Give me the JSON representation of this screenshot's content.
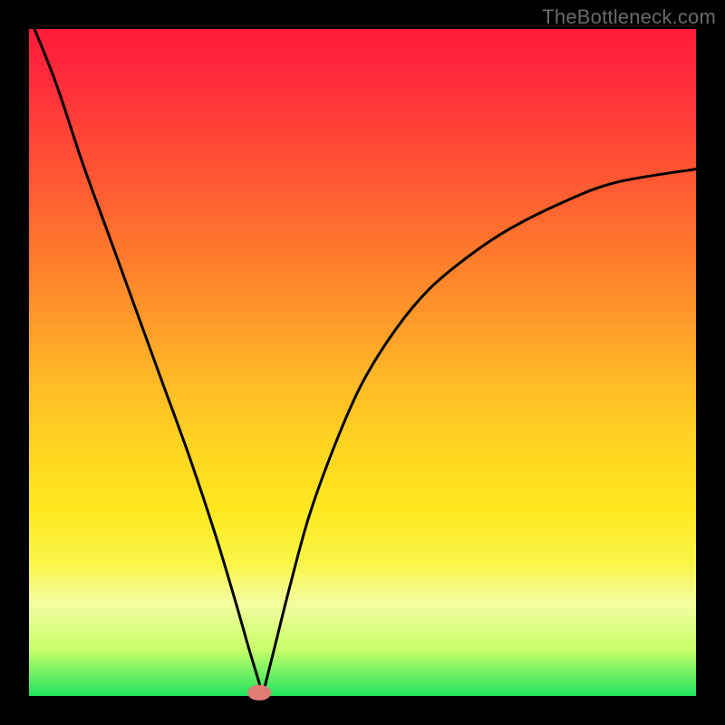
{
  "watermark": "TheBottleneck.com",
  "chart_data": {
    "type": "line",
    "title": "",
    "xlabel": "",
    "ylabel": "",
    "xlim": [
      0,
      1
    ],
    "ylim": [
      0,
      1
    ],
    "legend": false,
    "grid": false,
    "background_gradient": {
      "direction": "top-to-bottom",
      "stops": [
        {
          "pos": 0.0,
          "color": "#ff1c3a"
        },
        {
          "pos": 0.5,
          "color": "#ffb726"
        },
        {
          "pos": 0.85,
          "color": "#f4fca0"
        },
        {
          "pos": 1.0,
          "color": "#20e45c"
        }
      ]
    },
    "series": [
      {
        "name": "bottleneck-curve",
        "x": [
          0.0,
          0.04,
          0.08,
          0.12,
          0.16,
          0.2,
          0.24,
          0.28,
          0.31,
          0.33,
          0.345,
          0.35,
          0.355,
          0.37,
          0.39,
          0.42,
          0.46,
          0.5,
          0.55,
          0.6,
          0.66,
          0.72,
          0.8,
          0.88,
          1.0
        ],
        "y": [
          1.02,
          0.92,
          0.8,
          0.69,
          0.58,
          0.47,
          0.36,
          0.24,
          0.14,
          0.07,
          0.02,
          0.0,
          0.02,
          0.08,
          0.16,
          0.27,
          0.38,
          0.47,
          0.55,
          0.61,
          0.66,
          0.7,
          0.74,
          0.77,
          0.79
        ]
      }
    ],
    "marker": {
      "x": 0.345,
      "y": 0.005,
      "width_frac": 0.035,
      "height_frac": 0.022,
      "color": "#e17c77"
    },
    "curve_min_x": 0.35
  }
}
